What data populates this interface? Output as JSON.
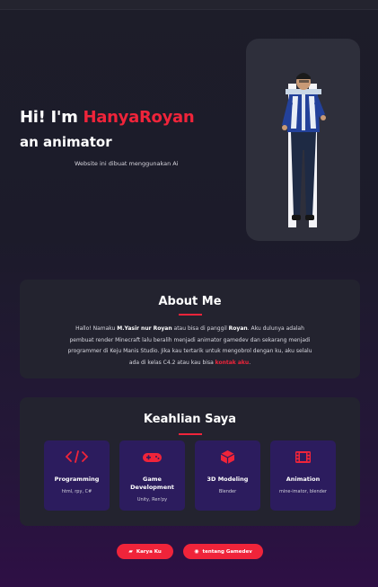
{
  "hero": {
    "greeting": "Hi! I'm ",
    "name": "HanyaRoyan",
    "role": "an animator",
    "note": "Website ini dibuat menggunakan Ai"
  },
  "about": {
    "title": "About Me",
    "p1": "Hallo! Namaku ",
    "p1_bold": "M.Yasir nur Royan",
    "p2": " atau bisa di panggil ",
    "p2_bold": "Royan",
    "p3": ". Aku dulunya adalah pembuat render Minecraft lalu beralih menjadi animator gamedev dan sekarang menjadi programmer di Keju Manis Studio. Jika kau tertarik untuk mengobrol dengan ku, aku selalu ada di kelas C4.2 atau kau bisa ",
    "link": "kontak aku",
    "p4": "."
  },
  "skills": {
    "title": "Keahlian Saya",
    "items": [
      {
        "name": "Programming",
        "tools": "html, rpy, C#",
        "icon": "code-icon"
      },
      {
        "name": "Game Development",
        "tools": "Unity, Ren'py",
        "icon": "gamepad-icon"
      },
      {
        "name": "3D Modeling",
        "tools": "Blender",
        "icon": "cube-icon"
      },
      {
        "name": "Animation",
        "tools": "mine-imator, blender",
        "icon": "film-icon"
      }
    ]
  },
  "buttons": {
    "works": "Karya Ku",
    "about_gamedev": "tentang Gamedev"
  },
  "colors": {
    "accent": "#f0243a",
    "card": "#23232f",
    "skill_card": "#2c1c5e"
  }
}
